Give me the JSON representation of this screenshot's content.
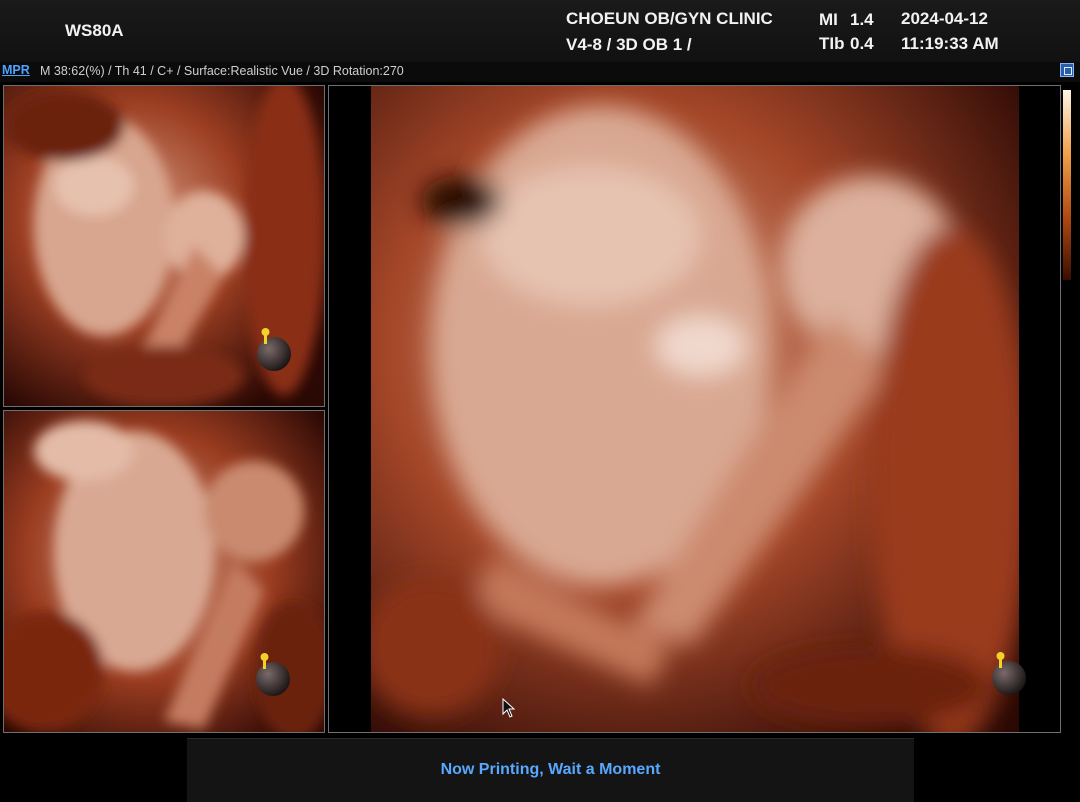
{
  "header": {
    "device": "WS80A",
    "clinic": "CHOEUN OB/GYN CLINIC",
    "probe_preset": "V4-8 / 3D OB 1 /",
    "mi_label": "MI",
    "mi_value": "1.4",
    "tib_label": "TIb",
    "tib_value": "0.4",
    "date": "2024-04-12",
    "time": "11:19:33 AM"
  },
  "infobar": {
    "mode": "MPR",
    "params": "M 38:62(%) / Th 41 / C+ / Surface:Realistic Vue / 3D Rotation:270"
  },
  "views": {
    "marker_icon": "orientation-marker-icon",
    "count": 3
  },
  "status": {
    "message": "Now Printing, Wait a Moment"
  },
  "colors": {
    "accent_blue": "#58a8ff",
    "render_dark": "#2a0804",
    "render_mid": "#a8442a",
    "render_light": "#e8b59c"
  }
}
